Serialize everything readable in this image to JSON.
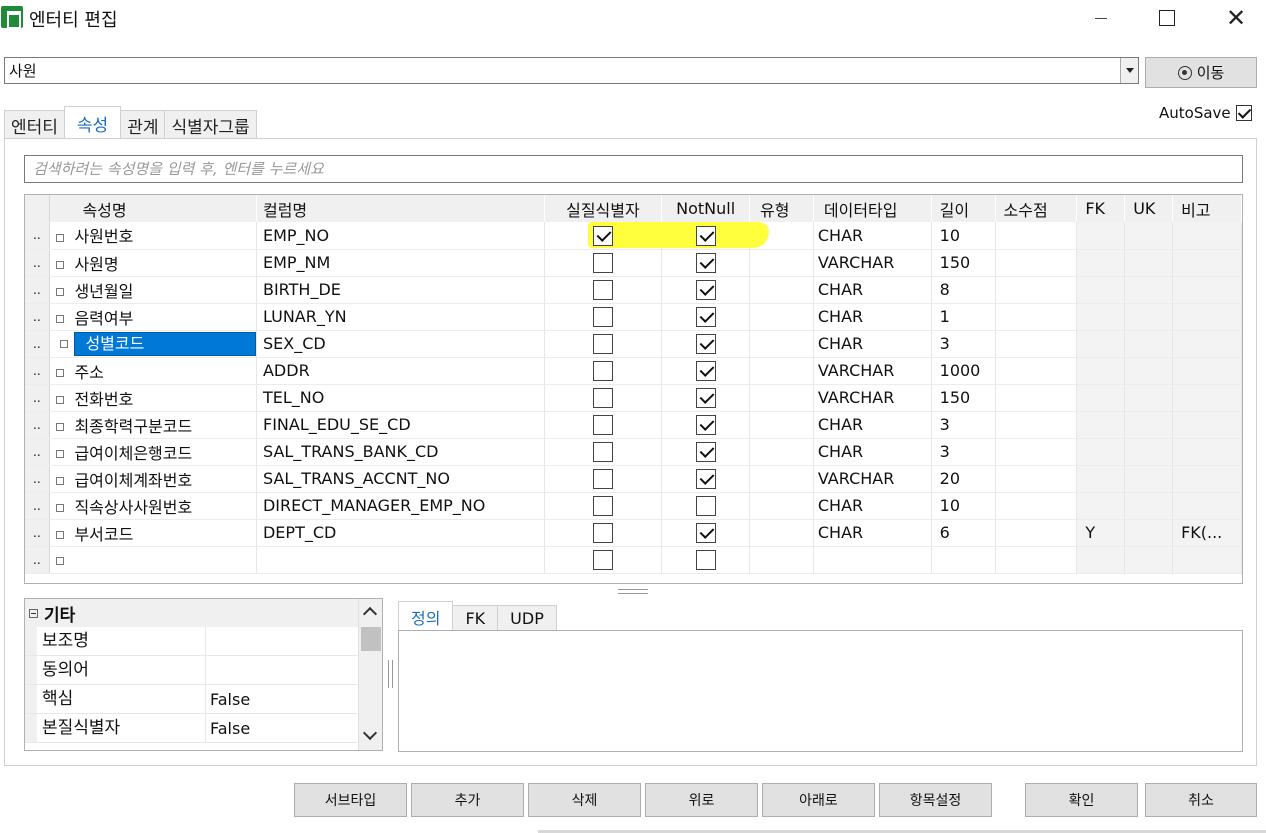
{
  "window": {
    "title": "엔터티 편집",
    "close_glyph": "✕"
  },
  "entity": {
    "selected": "사원",
    "move_label": "이동"
  },
  "tabs": [
    {
      "label": "엔터티"
    },
    {
      "label": "속성",
      "active": true
    },
    {
      "label": "관계"
    },
    {
      "label": "식별자그룹"
    }
  ],
  "autosave": {
    "label": "AutoSave",
    "checked": true
  },
  "search": {
    "placeholder": "검색하려는 속성명을 입력 후, 엔터를 누르세요"
  },
  "grid": {
    "columns": [
      "속성명",
      "컬럼명",
      "실질식별자",
      "NotNull",
      "유형",
      "데이터타입",
      "길이",
      "소수점",
      "FK",
      "UK",
      "비고"
    ],
    "row_marker": "..",
    "rows": [
      {
        "name": "사원번호",
        "column": "EMP_NO",
        "pk": true,
        "notnull": true,
        "type": "",
        "datatype": "CHAR",
        "length": "10",
        "scale": "",
        "fk": "",
        "uk": "",
        "note": ""
      },
      {
        "name": "사원명",
        "column": "EMP_NM",
        "pk": false,
        "notnull": true,
        "type": "",
        "datatype": "VARCHAR",
        "length": "150",
        "scale": "",
        "fk": "",
        "uk": "",
        "note": ""
      },
      {
        "name": "생년월일",
        "column": "BIRTH_DE",
        "pk": false,
        "notnull": true,
        "type": "",
        "datatype": "CHAR",
        "length": "8",
        "scale": "",
        "fk": "",
        "uk": "",
        "note": ""
      },
      {
        "name": "음력여부",
        "column": "LUNAR_YN",
        "pk": false,
        "notnull": true,
        "type": "",
        "datatype": "CHAR",
        "length": "1",
        "scale": "",
        "fk": "",
        "uk": "",
        "note": ""
      },
      {
        "name": "성별코드",
        "column": "SEX_CD",
        "pk": false,
        "notnull": true,
        "type": "",
        "datatype": "CHAR",
        "length": "3",
        "scale": "",
        "fk": "",
        "uk": "",
        "note": "",
        "selected": true
      },
      {
        "name": "주소",
        "column": "ADDR",
        "pk": false,
        "notnull": true,
        "type": "",
        "datatype": "VARCHAR",
        "length": "1000",
        "scale": "",
        "fk": "",
        "uk": "",
        "note": ""
      },
      {
        "name": "전화번호",
        "column": "TEL_NO",
        "pk": false,
        "notnull": true,
        "type": "",
        "datatype": "VARCHAR",
        "length": "150",
        "scale": "",
        "fk": "",
        "uk": "",
        "note": ""
      },
      {
        "name": "최종학력구분코드",
        "column": "FINAL_EDU_SE_CD",
        "pk": false,
        "notnull": true,
        "type": "",
        "datatype": "CHAR",
        "length": "3",
        "scale": "",
        "fk": "",
        "uk": "",
        "note": ""
      },
      {
        "name": "급여이체은행코드",
        "column": "SAL_TRANS_BANK_CD",
        "pk": false,
        "notnull": true,
        "type": "",
        "datatype": "CHAR",
        "length": "3",
        "scale": "",
        "fk": "",
        "uk": "",
        "note": ""
      },
      {
        "name": "급여이체계좌번호",
        "column": "SAL_TRANS_ACCNT_NO",
        "pk": false,
        "notnull": true,
        "type": "",
        "datatype": "VARCHAR",
        "length": "20",
        "scale": "",
        "fk": "",
        "uk": "",
        "note": ""
      },
      {
        "name": "직속상사사원번호",
        "column": "DIRECT_MANAGER_EMP_NO",
        "pk": false,
        "notnull": false,
        "type": "",
        "datatype": "CHAR",
        "length": "10",
        "scale": "",
        "fk": "",
        "uk": "",
        "note": ""
      },
      {
        "name": "부서코드",
        "column": "DEPT_CD",
        "pk": false,
        "notnull": true,
        "type": "",
        "datatype": "CHAR",
        "length": "6",
        "scale": "",
        "fk": "Y",
        "uk": "",
        "note": "FK(..."
      },
      {
        "name": "",
        "column": "",
        "pk": false,
        "notnull": false,
        "type": "",
        "datatype": "",
        "length": "",
        "scale": "",
        "fk": "",
        "uk": "",
        "note": ""
      }
    ]
  },
  "properties": {
    "category": "기타",
    "rows": [
      {
        "name": "보조명",
        "value": ""
      },
      {
        "name": "동의어",
        "value": ""
      },
      {
        "name": "핵심",
        "value": "False"
      },
      {
        "name": "본질식별자",
        "value": "False"
      }
    ]
  },
  "bottom_tabs": [
    {
      "label": "정의",
      "active": true
    },
    {
      "label": "FK"
    },
    {
      "label": "UDP"
    }
  ],
  "buttons": {
    "subtype": "서브타입",
    "add": "추가",
    "delete": "삭제",
    "up": "위로",
    "down": "아래로",
    "item_settings": "항목설정",
    "ok": "확인",
    "cancel": "취소"
  },
  "colors": {
    "accent": "#1a6fc0",
    "selection": "#0078d7",
    "highlight": "#ffff33"
  }
}
